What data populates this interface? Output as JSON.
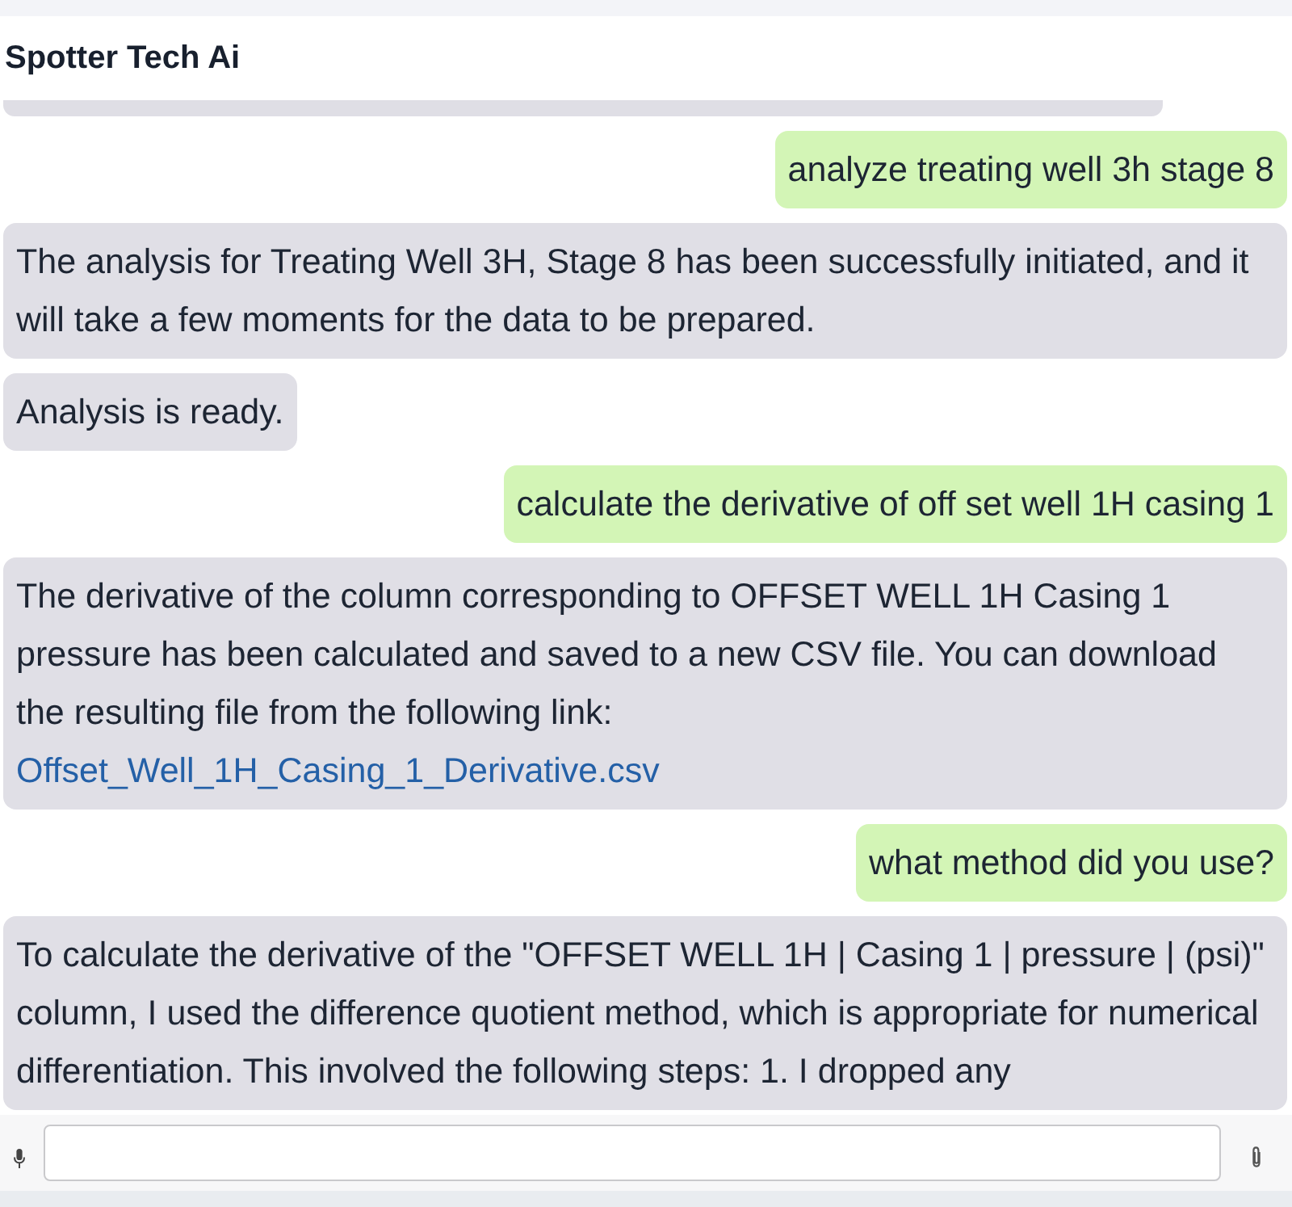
{
  "header": {
    "title": "Spotter Tech Ai"
  },
  "messages": [
    {
      "kind": "user",
      "text": "analyze treating well 3h stage 8"
    },
    {
      "kind": "assistant",
      "text": "The analysis for Treating Well 3H, Stage 8 has been successfully initiated, and it will take a few moments for the data to be prepared."
    },
    {
      "kind": "assistant",
      "text": "Analysis is ready."
    },
    {
      "kind": "user",
      "text": "calculate the derivative of off set well 1H casing 1"
    },
    {
      "kind": "assistant",
      "text": "The derivative of the column corresponding to OFFSET WELL 1H Casing 1 pressure has been calculated and saved to a new CSV file. You can download the resulting file from the following link:",
      "link": "Offset_Well_1H_Casing_1_Derivative.csv"
    },
    {
      "kind": "user",
      "text": "what method did you use?"
    },
    {
      "kind": "assistant",
      "text": "To calculate the derivative of the \"OFFSET WELL 1H | Casing 1 | pressure | (psi)\" column, I used the difference quotient method, which is appropriate for numerical differentiation. This involved the following steps: 1. I dropped any"
    }
  ]
}
